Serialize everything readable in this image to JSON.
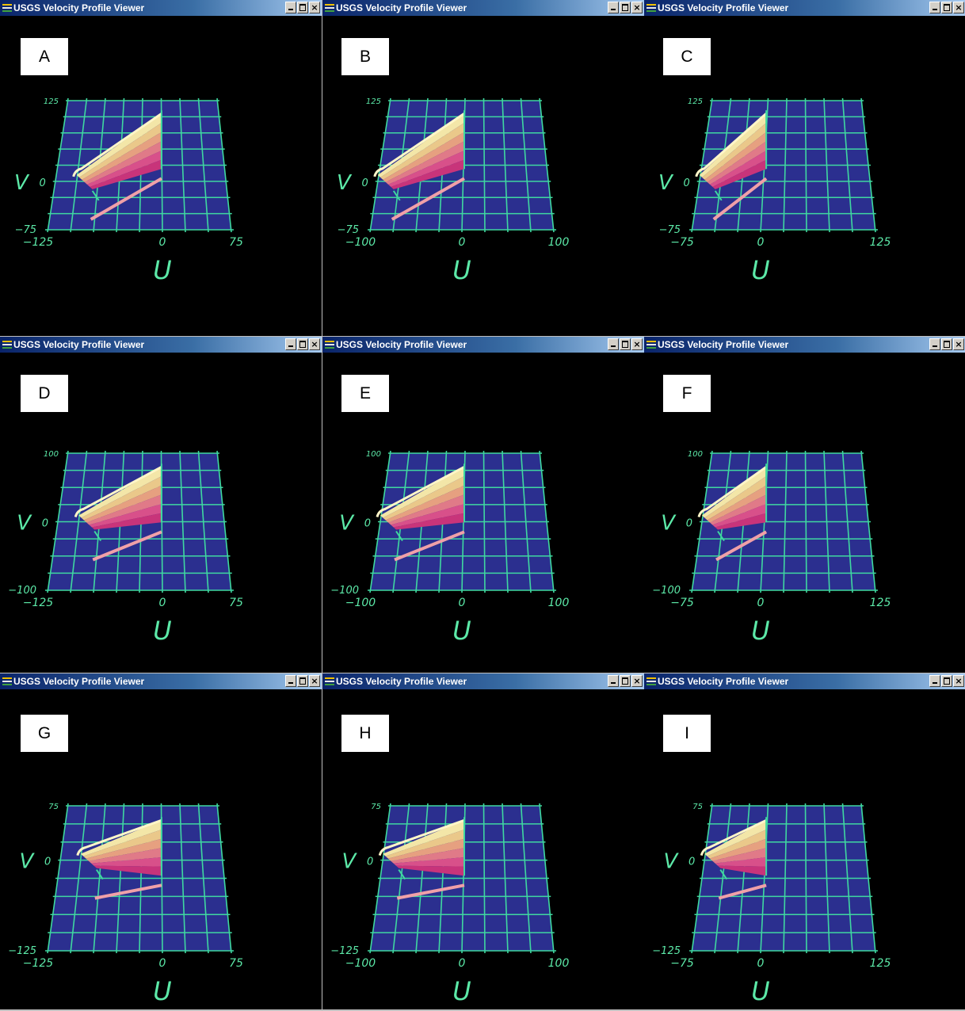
{
  "window_title": "USGS Velocity Profile Viewer",
  "title_icon": "app-icon",
  "window_controls": [
    "minimize",
    "maximize",
    "close"
  ],
  "colors": {
    "grid_plane": "#2b2f8f",
    "grid_lines": "#3fd8a0",
    "axis_labels": "#5ce9a8",
    "background": "#000000"
  },
  "axis_labels": {
    "u": "U",
    "v": "V"
  },
  "panels": [
    {
      "id": "A",
      "u_ticks": [
        "−125",
        "0",
        "75"
      ],
      "v_ticks": [
        "125",
        "0",
        "−75"
      ]
    },
    {
      "id": "B",
      "u_ticks": [
        "−100",
        "0",
        "100"
      ],
      "v_ticks": [
        "125",
        "0",
        "−75"
      ]
    },
    {
      "id": "C",
      "u_ticks": [
        "−75",
        "0",
        "125"
      ],
      "v_ticks": [
        "125",
        "0",
        "−75"
      ]
    },
    {
      "id": "D",
      "u_ticks": [
        "−125",
        "0",
        "75"
      ],
      "v_ticks": [
        "100",
        "0",
        "−100"
      ]
    },
    {
      "id": "E",
      "u_ticks": [
        "−100",
        "0",
        "100"
      ],
      "v_ticks": [
        "100",
        "0",
        "−100"
      ]
    },
    {
      "id": "F",
      "u_ticks": [
        "−75",
        "0",
        "125"
      ],
      "v_ticks": [
        "100",
        "0",
        "−100"
      ]
    },
    {
      "id": "G",
      "u_ticks": [
        "−125",
        "0",
        "75"
      ],
      "v_ticks": [
        "75",
        "0",
        "−125"
      ]
    },
    {
      "id": "H",
      "u_ticks": [
        "−100",
        "0",
        "100"
      ],
      "v_ticks": [
        "75",
        "0",
        "−125"
      ]
    },
    {
      "id": "I",
      "u_ticks": [
        "−75",
        "0",
        "125"
      ],
      "v_ticks": [
        "75",
        "0",
        "−125"
      ]
    }
  ]
}
